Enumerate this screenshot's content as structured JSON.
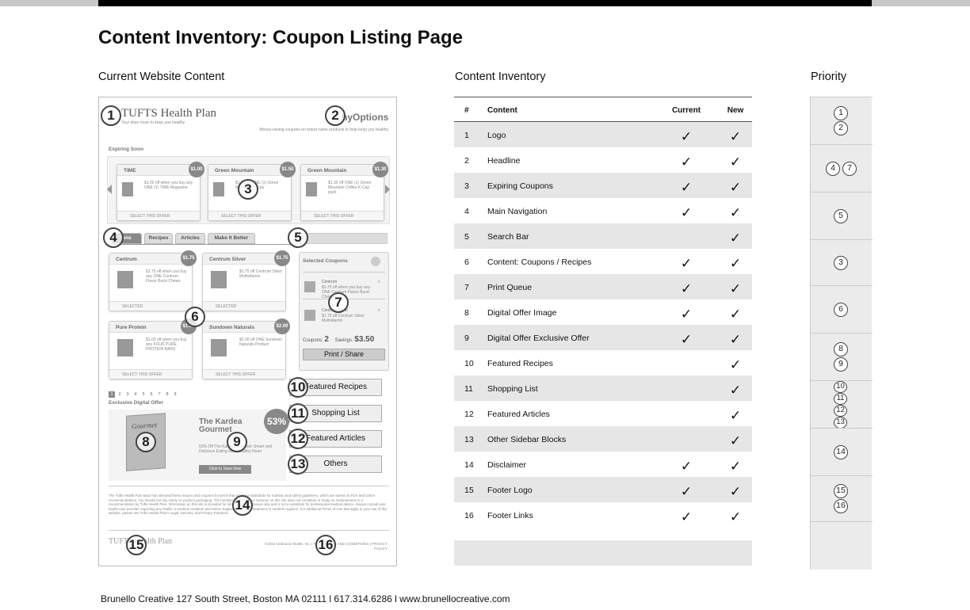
{
  "page": {
    "title": "Content Inventory: Coupon Listing Page",
    "footer": "Brunello Creative 127 South Street, Boston MA 02111 l 617.314.6286 l www.brunellocreative.com"
  },
  "sections": {
    "current": "Current Website Content",
    "inventory": "Content Inventory",
    "priority": "Priority"
  },
  "wireframe": {
    "logo": "TUFTS Health Plan",
    "logo_tagline": "Your does more to keep you healthy.",
    "brand_right": "hyOptions",
    "brand_tagline": "Money-saving coupons on brand name products to help keep you healthy.",
    "expiring_label": "Expiring Soon",
    "expiring_cards": [
      {
        "name": "TIME",
        "badge": "$1.00",
        "desc": "$1.00 off when you buy any ONE (1) TIME Magazine",
        "footer": "SELECT THIS OFFER"
      },
      {
        "name": "Green Mountain",
        "badge": "$1.50",
        "desc": "$1.50 off ONE (1) Green Mountain K-Cup",
        "footer": "SELECT THIS OFFER"
      },
      {
        "name": "Green Mountain",
        "badge": "$1.30",
        "desc": "$1.30 off ONE (1) Green Mountain Coffee K-Cup pack",
        "footer": "SELECT THIS OFFER"
      }
    ],
    "tabs": [
      "ons",
      "Recipes",
      "Articles",
      "Make It Better"
    ],
    "coupon_cards": [
      {
        "name": "Centrum",
        "badge": "$1.75",
        "desc": "$1.75 off when you buy any ONE Centrum Flavor Burst Chews",
        "footer": "SELECTED"
      },
      {
        "name": "Centrum Silver",
        "badge": "$1.75",
        "desc": "$1.75 off Centrum Silver Multivitamin",
        "footer": "SELECTED"
      },
      {
        "name": "Pure Protein",
        "badge": "$1.00",
        "desc": "$1.00 off when you buy any FOUR PURE PROTEIN BARS",
        "footer": "SELECT THIS OFFER"
      },
      {
        "name": "Sundown Naturals",
        "badge": "$2.00",
        "desc": "$2.00 off ONE Sundown Naturals Product",
        "footer": "SELECT THIS OFFER"
      }
    ],
    "selected_title": "Selected Coupons",
    "selected_items": [
      {
        "name": "Centrum",
        "desc": "$1.75 off when you buy any ONE Centrum Flavor Burst Chews"
      },
      {
        "name": "Centrum Silver",
        "desc": "$1.75 off Centrum Silver Multivitamin"
      }
    ],
    "coupons_label": "Coupons:",
    "coupons_count": "2",
    "savings_label": "Savings:",
    "savings_value": "$3.50",
    "print_button": "Print / Share",
    "pager": [
      "1",
      "2",
      "3",
      "4",
      "5",
      "6",
      "7",
      "8",
      "9"
    ],
    "exclusive_label": "Exclusive Digital Offer",
    "exclusive_badge": "53%",
    "book_word": "Gourmet",
    "exclusive_title": "The Kardea Gourmet",
    "exclusive_desc": "53% Off The Kardea Gourmet: Smart and Delicious Eating for a Healthy Heart",
    "exclusive_button": "Click to Save Now",
    "side_buttons": [
      "Featured Recipes",
      "Shopping List",
      "Featured Articles",
      "Others"
    ],
    "disclaimer": "The Tufts Health Plan team has selected these recipes and coupons for items that meet our standards for nutrition and safety guidelines, which are based on FDA and USDA recommendations. You should not rely solely on product packaging. The mention of products or services on this site does not constitute or imply an endorsement or a recommendation by Tufts Health Plan. Information on this site is provided for informational purposes only and is not a substitute for professional medical advice. Always consult your health care provider regarding any health or medical condition and before beginning any new treatment or nutrition regimen. For additional Terms of Use that apply to your use of this website, please see Tufts Health Plan's Legal, Security, and Privacy Practices.",
    "footer_logo": "TUFTS Health Plan",
    "footer_links": "©2013 Unbound Health, Inc.   |   FAQ   |   TERMS AND CONDITIONS   |   PRIVACY POLICY"
  },
  "annotations": [
    "1",
    "2",
    "3",
    "4",
    "5",
    "6",
    "7",
    "8",
    "9",
    "10",
    "11",
    "12",
    "13",
    "14",
    "15",
    "16"
  ],
  "inventory": {
    "headers": {
      "num": "#",
      "content": "Content",
      "current": "Current",
      "new": "New"
    },
    "check": "✓",
    "rows": [
      {
        "num": "1",
        "name": "Logo",
        "current": true,
        "new": true
      },
      {
        "num": "2",
        "name": "Headline",
        "current": true,
        "new": true
      },
      {
        "num": "3",
        "name": "Expiring Coupons",
        "current": true,
        "new": true
      },
      {
        "num": "4",
        "name": "Main Navigation",
        "current": true,
        "new": true
      },
      {
        "num": "5",
        "name": "Search Bar",
        "current": false,
        "new": true
      },
      {
        "num": "6",
        "name": "Content: Coupons / Recipes",
        "current": true,
        "new": true
      },
      {
        "num": "7",
        "name": "Print Queue",
        "current": true,
        "new": true
      },
      {
        "num": "8",
        "name": "Digital Offer Image",
        "current": true,
        "new": true
      },
      {
        "num": "9",
        "name": "Digital Offer Exclusive Offer",
        "current": true,
        "new": true
      },
      {
        "num": "10",
        "name": "Featured Recipes",
        "current": false,
        "new": true
      },
      {
        "num": "11",
        "name": "Shopping List",
        "current": false,
        "new": true
      },
      {
        "num": "12",
        "name": "Featured Articles",
        "current": false,
        "new": true
      },
      {
        "num": "13",
        "name": "Other Sidebar Blocks",
        "current": false,
        "new": true
      },
      {
        "num": "14",
        "name": "Disclaimer",
        "current": true,
        "new": true
      },
      {
        "num": "15",
        "name": "Footer Logo",
        "current": true,
        "new": true
      },
      {
        "num": "16",
        "name": "Footer Links",
        "current": true,
        "new": true
      }
    ]
  },
  "priority": [
    [
      "1",
      "2"
    ],
    [
      "4",
      "7"
    ],
    [
      "5"
    ],
    [
      "3"
    ],
    [
      "6"
    ],
    [
      "8",
      "9"
    ],
    [
      "10",
      "11",
      "12",
      "13"
    ],
    [
      "14"
    ],
    [
      "15",
      "16"
    ],
    []
  ]
}
